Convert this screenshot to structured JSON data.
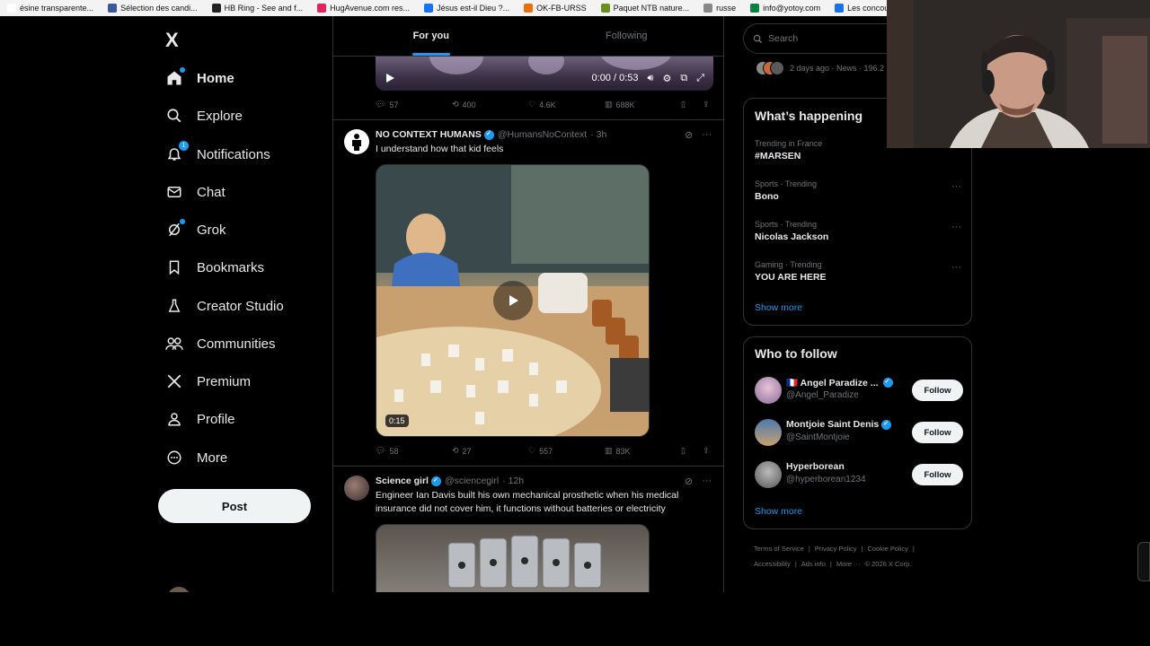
{
  "bookmarks": [
    {
      "label": "ésine transparente...",
      "color": "#ffffff"
    },
    {
      "label": "Sélection des candi...",
      "color": "#3b5998"
    },
    {
      "label": "HB Ring - See and f...",
      "color": "#222222"
    },
    {
      "label": "HugAvenue.com res...",
      "color": "#e0245e"
    },
    {
      "label": "Jésus est-il Dieu ?...",
      "color": "#1a73e8"
    },
    {
      "label": "OK-FB-URSS",
      "color": "#e8710a"
    },
    {
      "label": "Paquet NTB nature...",
      "color": "#6b8e23"
    },
    {
      "label": "russe",
      "color": "#888888"
    },
    {
      "label": "info@yotoy.com",
      "color": "#0b8043"
    },
    {
      "label": "Les concours d'aute...",
      "color": "#1a73e8"
    }
  ],
  "nav": {
    "logo": "X",
    "items": [
      {
        "label": "Home",
        "icon": "home-icon"
      },
      {
        "label": "Explore",
        "icon": "search-icon"
      },
      {
        "label": "Notifications",
        "icon": "bell-icon",
        "badge": "1"
      },
      {
        "label": "Chat",
        "icon": "mail-icon"
      },
      {
        "label": "Grok",
        "icon": "grok-icon"
      },
      {
        "label": "Bookmarks",
        "icon": "bookmark-icon"
      },
      {
        "label": "Creator Studio",
        "icon": "creator-icon"
      },
      {
        "label": "Communities",
        "icon": "communities-icon"
      },
      {
        "label": "Premium",
        "icon": "x-icon"
      },
      {
        "label": "Profile",
        "icon": "person-icon"
      },
      {
        "label": "More",
        "icon": "more-circle-icon"
      }
    ],
    "post_label": "Post"
  },
  "tabs": {
    "for_you": "For you",
    "following": "Following"
  },
  "top_video": {
    "time": "0:00 / 0:53",
    "replies": "57",
    "reposts": "400",
    "likes": "4.6K",
    "views": "688K"
  },
  "tweets": [
    {
      "name": "NO CONTEXT HUMANS",
      "handle": "@HumansNoContext",
      "time": "· 3h",
      "text": "I understand how that kid feels",
      "duration": "0:15",
      "replies": "58",
      "reposts": "27",
      "likes": "557",
      "views": "83K"
    },
    {
      "name": "Science girl",
      "handle": "@sciencegirl",
      "time": "· 12h",
      "text": "Engineer Ian Davis built his own mechanical prosthetic when his medical insurance did not cover him, it functions without batteries or electricity"
    }
  ],
  "right": {
    "search_placeholder": "Search",
    "news_meta": "2 days ago · News · 196.2",
    "happening_title": "What’s happening",
    "trends": [
      {
        "category": "Trending in France",
        "name": "#MARSEN"
      },
      {
        "category": "Sports · Trending",
        "name": "Bono"
      },
      {
        "category": "Sports · Trending",
        "name": "Nicolas Jackson"
      },
      {
        "category": "Gaming · Trending",
        "name": "YOU ARE HERE"
      }
    ],
    "show_more": "Show more",
    "who_title": "Who to follow",
    "who": [
      {
        "name": "🇫🇷 Angel Paradize ...",
        "handle": "@Angel_Paradize",
        "button": "Follow"
      },
      {
        "name": "Montjoie Saint Denis",
        "handle": "@SaintMontjoie",
        "button": "Follow"
      },
      {
        "name": "Hyperborean",
        "handle": "@hyperborean1234",
        "button": "Follow"
      }
    ],
    "who_show_more": "Show more",
    "footer": [
      "Terms of Service",
      "|",
      "Privacy Policy",
      "|",
      "Cookie Policy",
      "|",
      "Accessibility",
      "|",
      "Ads info",
      "|",
      "More ···",
      "© 2026 X Corp."
    ]
  },
  "colors": {
    "accent": "#1d9bf0",
    "border": "#2f3336",
    "muted": "#71767b"
  }
}
